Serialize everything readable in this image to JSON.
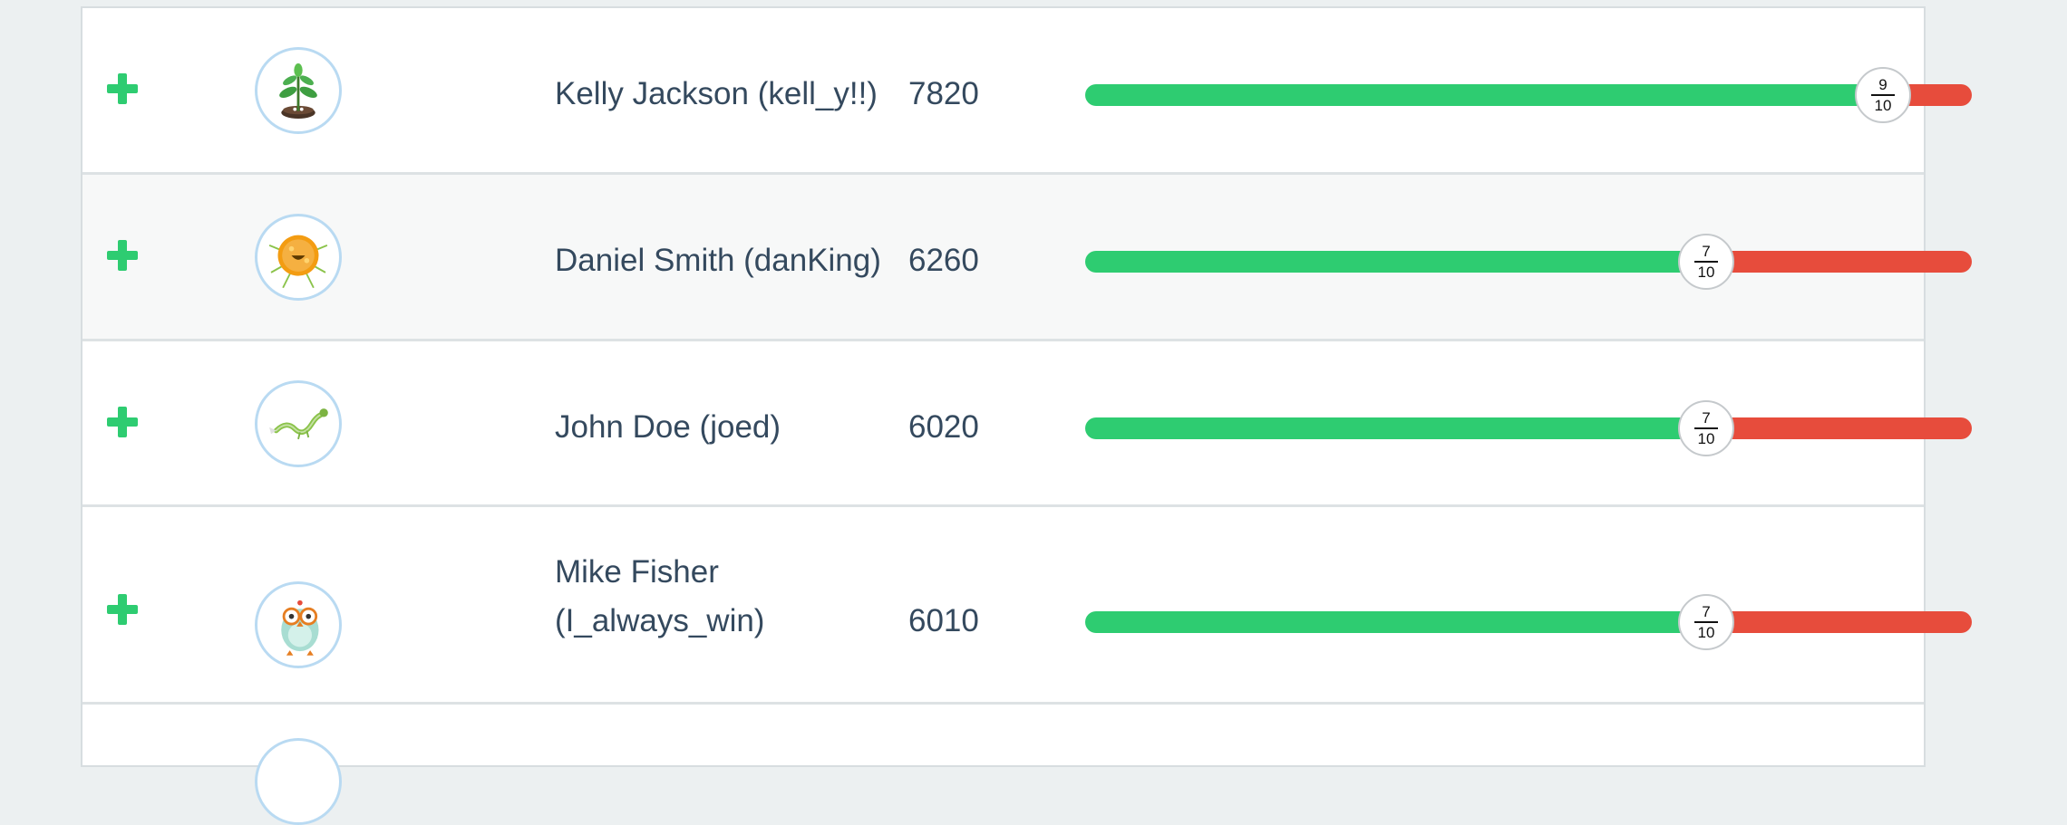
{
  "leaderboard": {
    "rows": [
      {
        "name": "Kelly Jackson (kell_y!!)",
        "score": "7820",
        "progress": {
          "numerator": "9",
          "denominator": "10",
          "fraction": 0.9
        },
        "avatar_icon": "sprout-plant-icon"
      },
      {
        "name": "Daniel Smith (danKing)",
        "score": "6260",
        "progress": {
          "numerator": "7",
          "denominator": "10",
          "fraction": 0.7
        },
        "avatar_icon": "orange-fluffy-monster-icon"
      },
      {
        "name": "John Doe (joed)",
        "score": "6020",
        "progress": {
          "numerator": "7",
          "denominator": "10",
          "fraction": 0.7
        },
        "avatar_icon": "green-dragon-icon"
      },
      {
        "name_line1": "Mike Fisher",
        "name_line2": "(I_always_win)",
        "score": "6010",
        "progress": {
          "numerator": "7",
          "denominator": "10",
          "fraction": 0.7
        },
        "avatar_icon": "owl-robot-icon"
      }
    ]
  },
  "colors": {
    "good": "#2ecc71",
    "bad": "#e74c3c",
    "text": "#34495e",
    "avatar_ring": "#b9daf2",
    "plus": "#2ecc71"
  }
}
